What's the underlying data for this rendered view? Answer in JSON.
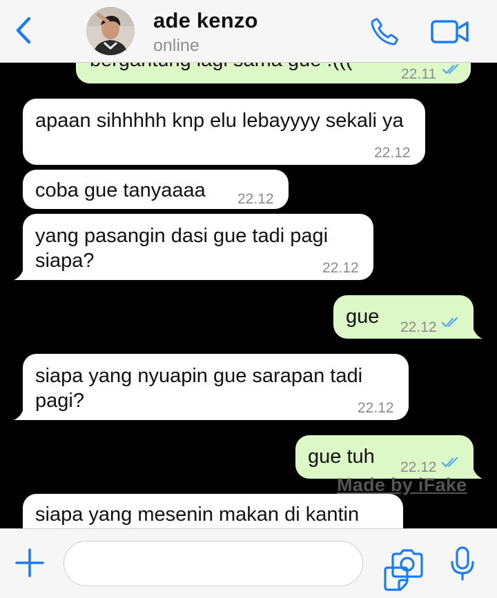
{
  "header": {
    "contact_name": "ade kenzo",
    "status": "online"
  },
  "messages": [
    {
      "dir": "out",
      "text": "bergantung lagi sama gue :(((",
      "time": "22.11",
      "read": true
    },
    {
      "dir": "in",
      "text": "apaan sihhhhh knp elu lebayyyy sekali ya",
      "time": "22.12"
    },
    {
      "dir": "in",
      "text": "coba gue tanyaaaa",
      "time": "22.12"
    },
    {
      "dir": "in",
      "text": "yang pasangin dasi gue tadi pagi siapa?",
      "time": "22.12"
    },
    {
      "dir": "out",
      "text": "gue",
      "time": "22.12",
      "read": true
    },
    {
      "dir": "in",
      "text": "siapa yang nyuapin gue sarapan tadi pagi?",
      "time": "22.12"
    },
    {
      "dir": "out",
      "text": "gue tuh",
      "time": "22.12",
      "read": true
    },
    {
      "dir": "in",
      "text": "siapa yang mesenin makan di kantin",
      "time": ""
    }
  ],
  "watermark": "Made by iFake",
  "input": {
    "placeholder": ""
  },
  "colors": {
    "accent": "#1a7cf5",
    "incoming_bubble": "#ffffff",
    "outgoing_bubble": "#dcf8c6",
    "read_ticks": "#4fa8f0",
    "background": "#000000"
  },
  "icons": {
    "back": "chevron-left-icon",
    "call": "phone-icon",
    "video": "video-camera-icon",
    "plus": "plus-icon",
    "sticker": "sticker-icon",
    "camera": "camera-icon",
    "mic": "microphone-icon"
  }
}
